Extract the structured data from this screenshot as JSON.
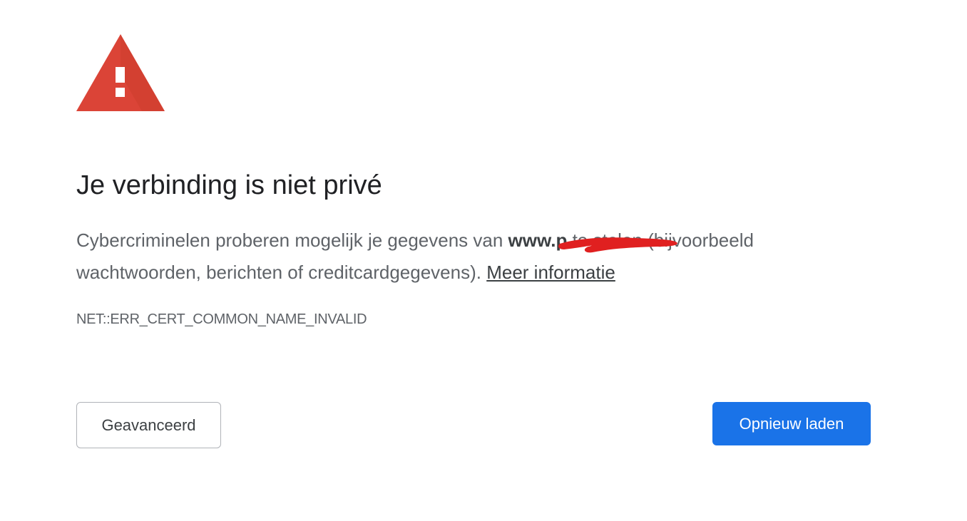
{
  "icon": {
    "name": "warning-triangle-icon",
    "color": "#db4437",
    "glyph": "!"
  },
  "title": "Je verbinding is niet privé",
  "message": {
    "before": "Cybercriminelen proberen mogelijk je gegevens van ",
    "domain": "www.p",
    "after": " te stelen (bijvoorbeeld wachtwoorden, berichten of creditcardgegevens). ",
    "link_label": "Meer informatie"
  },
  "error_code": "NET::ERR_CERT_COMMON_NAME_INVALID",
  "buttons": {
    "advanced_label": "Geavanceerd",
    "reload_label": "Opnieuw laden"
  },
  "colors": {
    "primary_button": "#1a73e8",
    "redaction_mark": "#e02020"
  }
}
